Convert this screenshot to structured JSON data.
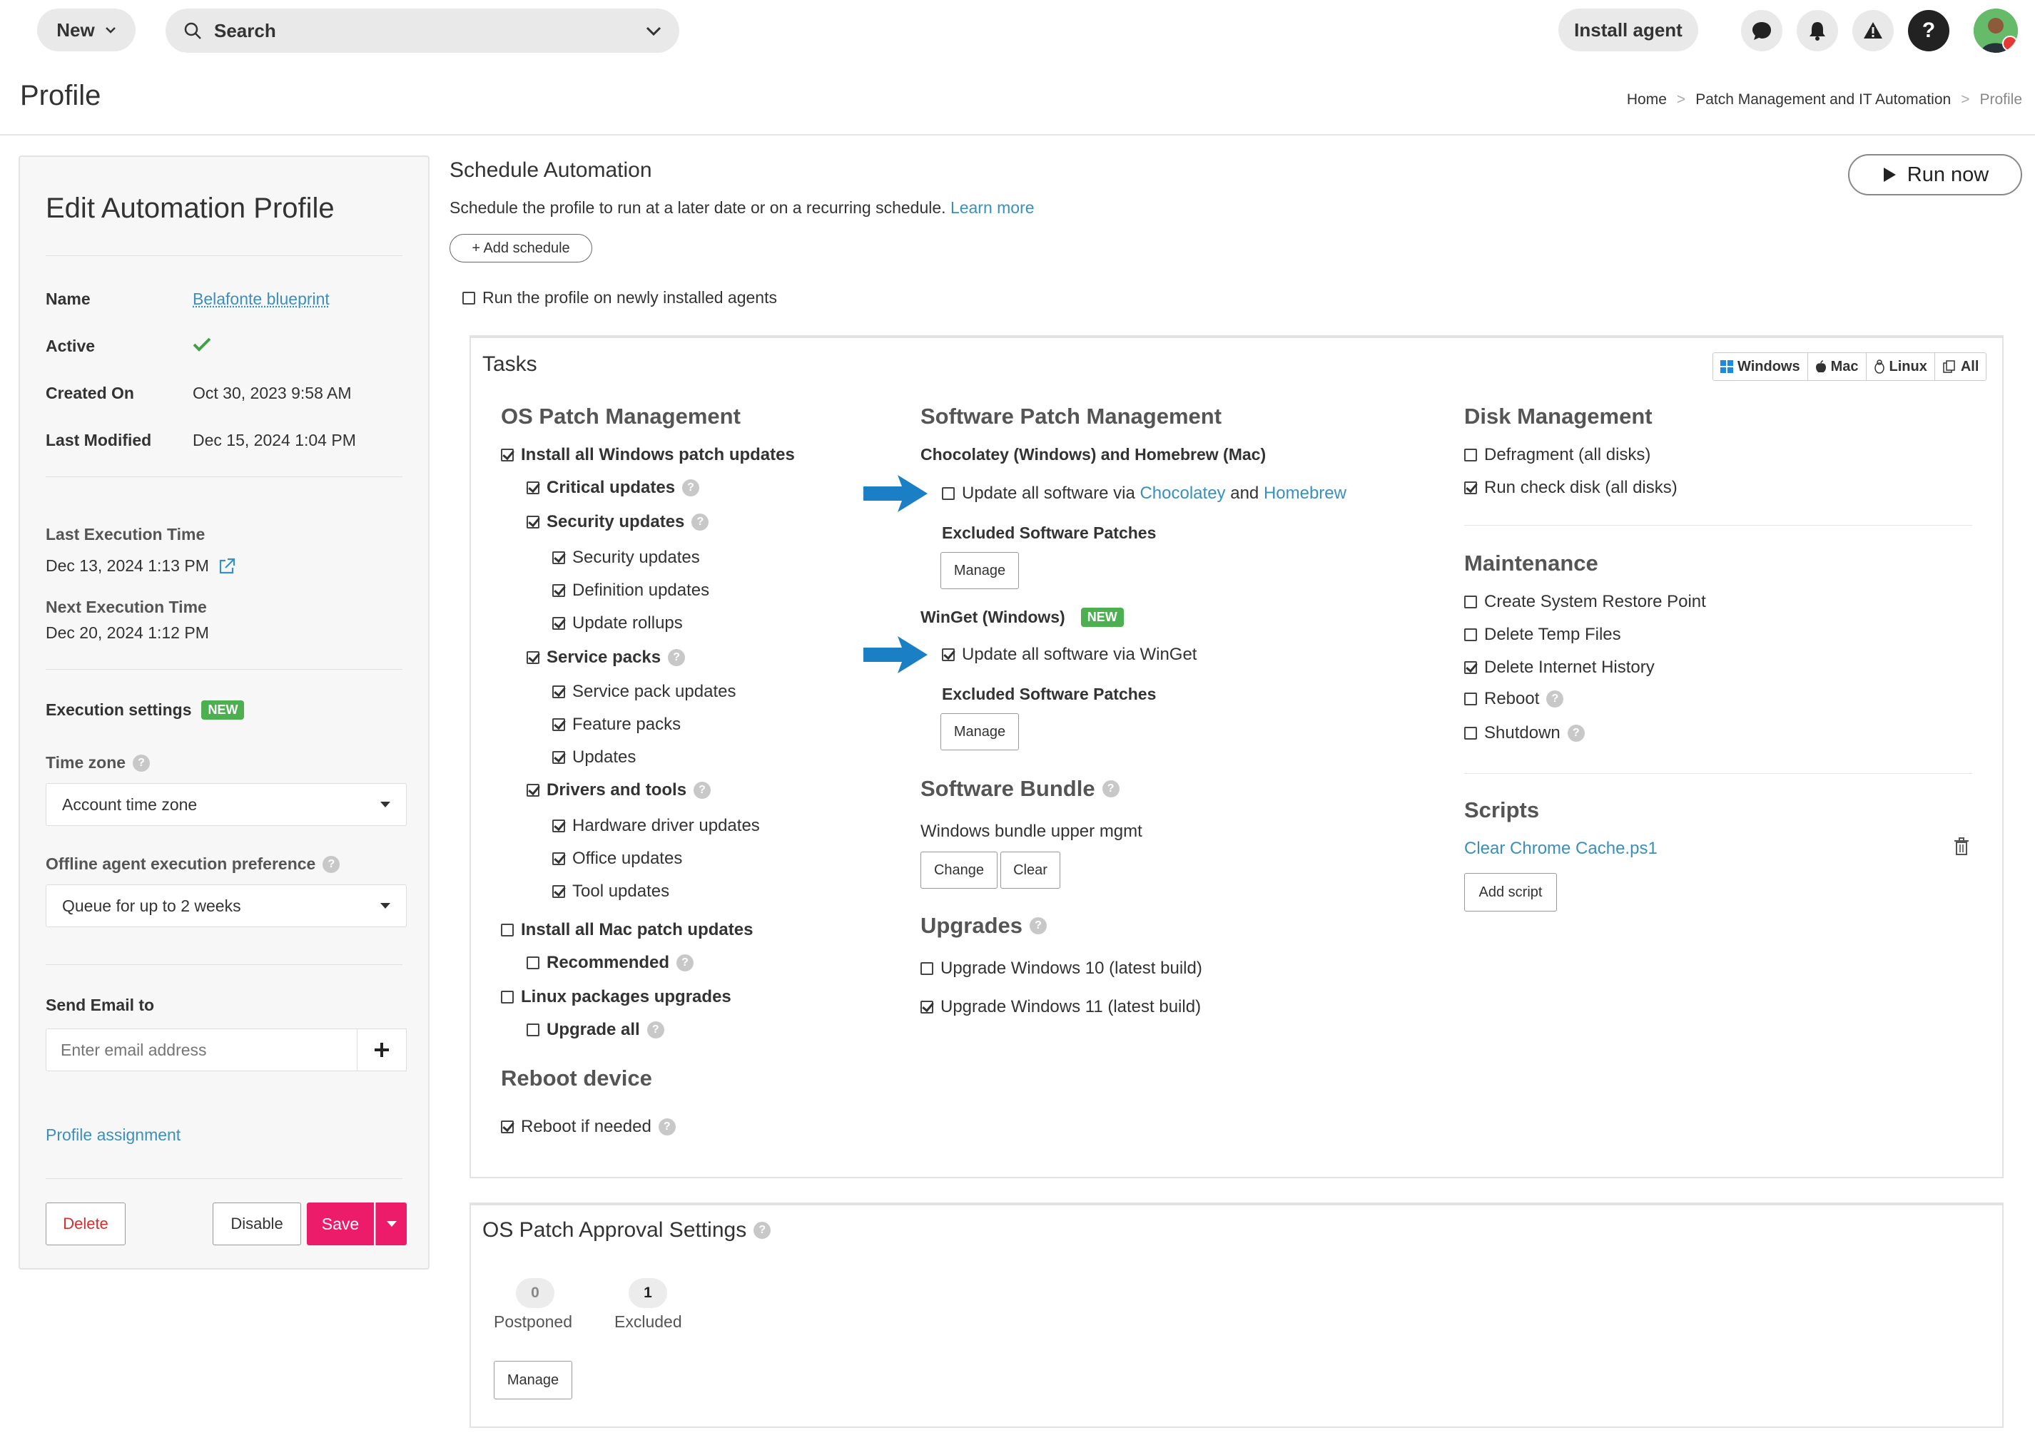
{
  "topbar": {
    "new_label": "New",
    "search_label": "Search",
    "install_label": "Install agent",
    "help_label": "?"
  },
  "page": {
    "title": "Profile",
    "breadcrumb": [
      "Home",
      "Patch Management and IT Automation",
      "Profile"
    ]
  },
  "left": {
    "title": "Edit Automation Profile",
    "fields": [
      {
        "label": "Name",
        "value": "Belafonte blueprint"
      },
      {
        "label": "Active",
        "value": ""
      },
      {
        "label": "Created On",
        "value": "Oct 30, 2023 9:58 AM"
      },
      {
        "label": "Last Modified",
        "value": "Dec 15, 2024 1:04 PM"
      }
    ],
    "last_exec_label": "Last Execution Time",
    "last_exec_value": "Dec 13, 2024 1:13 PM",
    "next_exec_label": "Next Execution Time",
    "next_exec_value": "Dec 20, 2024 1:12 PM",
    "exec_settings_label": "Execution settings",
    "new_badge": "NEW",
    "timezone_label": "Time zone",
    "timezone_value": "Account time zone",
    "offline_label": "Offline agent execution preference",
    "offline_value": "Queue for up to 2 weeks",
    "email_label": "Send Email to",
    "email_placeholder": "Enter email address",
    "assignment_link": "Profile assignment",
    "delete_label": "Delete",
    "disable_label": "Disable",
    "save_label": "Save"
  },
  "schedule": {
    "title": "Schedule Automation",
    "desc": "Schedule the profile to run at a later date or on a recurring schedule.",
    "learn_more": "Learn more",
    "add_schedule": "+ Add schedule",
    "run_new_agents": "Run the profile on newly installed agents",
    "run_now": "Run now"
  },
  "tasks": {
    "title": "Tasks",
    "os_filters": [
      "Windows",
      "Mac",
      "Linux",
      "All"
    ],
    "os_patch": {
      "title": "OS Patch Management",
      "items": [
        {
          "label": "Install all Windows patch updates",
          "checked": true,
          "level": 0,
          "bold": true,
          "help": false
        },
        {
          "label": "Critical updates",
          "checked": true,
          "level": 1,
          "bold": true,
          "help": true
        },
        {
          "label": "Security updates",
          "checked": true,
          "level": 1,
          "bold": true,
          "help": true
        },
        {
          "label": "Security updates",
          "checked": true,
          "level": 2,
          "bold": false,
          "help": false
        },
        {
          "label": "Definition updates",
          "checked": true,
          "level": 2,
          "bold": false,
          "help": false
        },
        {
          "label": "Update rollups",
          "checked": true,
          "level": 2,
          "bold": false,
          "help": false
        },
        {
          "label": "Service packs",
          "checked": true,
          "level": 1,
          "bold": true,
          "help": true
        },
        {
          "label": "Service pack updates",
          "checked": true,
          "level": 2,
          "bold": false,
          "help": false
        },
        {
          "label": "Feature packs",
          "checked": true,
          "level": 2,
          "bold": false,
          "help": false
        },
        {
          "label": "Updates",
          "checked": true,
          "level": 2,
          "bold": false,
          "help": false
        },
        {
          "label": "Drivers and tools",
          "checked": true,
          "level": 1,
          "bold": true,
          "help": true
        },
        {
          "label": "Hardware driver updates",
          "checked": true,
          "level": 2,
          "bold": false,
          "help": false
        },
        {
          "label": "Office updates",
          "checked": true,
          "level": 2,
          "bold": false,
          "help": false
        },
        {
          "label": "Tool updates",
          "checked": true,
          "level": 2,
          "bold": false,
          "help": false
        },
        {
          "label": "Install all Mac patch updates",
          "checked": false,
          "level": 0,
          "bold": true,
          "help": false
        },
        {
          "label": "Recommended",
          "checked": false,
          "level": 1,
          "bold": true,
          "help": true
        },
        {
          "label": "Linux packages upgrades",
          "checked": false,
          "level": 0,
          "bold": true,
          "help": false
        },
        {
          "label": "Upgrade all",
          "checked": false,
          "level": 1,
          "bold": true,
          "help": true
        }
      ]
    },
    "reboot": {
      "title": "Reboot device",
      "label": "Reboot if needed"
    },
    "software": {
      "title": "Software Patch Management",
      "choco_title": "Chocolatey (Windows) and Homebrew (Mac)",
      "choco_prefix": "Update all software via",
      "choco_link1": "Chocolatey",
      "choco_and": "and",
      "choco_link2": "Homebrew",
      "excluded": "Excluded Software Patches",
      "manage": "Manage",
      "winget_title": "WinGet (Windows)",
      "winget_label": "Update all software via WinGet"
    },
    "bundle": {
      "title": "Software Bundle",
      "value": "Windows bundle upper mgmt",
      "change": "Change",
      "clear": "Clear"
    },
    "upgrades": {
      "title": "Upgrades",
      "items": [
        {
          "label": "Upgrade Windows 10 (latest build)",
          "checked": false
        },
        {
          "label": "Upgrade Windows 11 (latest build)",
          "checked": true
        }
      ]
    },
    "disk": {
      "title": "Disk Management",
      "items": [
        {
          "label": "Defragment (all disks)",
          "checked": false
        },
        {
          "label": "Run check disk (all disks)",
          "checked": true
        }
      ]
    },
    "maintenance": {
      "title": "Maintenance",
      "items": [
        {
          "label": "Create System Restore Point",
          "checked": false,
          "help": false
        },
        {
          "label": "Delete Temp Files",
          "checked": false,
          "help": false
        },
        {
          "label": "Delete Internet History",
          "checked": true,
          "help": false
        },
        {
          "label": "Reboot",
          "checked": false,
          "help": true
        },
        {
          "label": "Shutdown",
          "checked": false,
          "help": true
        }
      ]
    },
    "scripts": {
      "title": "Scripts",
      "script": "Clear Chrome Cache.ps1",
      "add": "Add script"
    }
  },
  "approval": {
    "title": "OS Patch Approval Settings",
    "postponed_count": "0",
    "postponed_label": "Postponed",
    "excluded_count": "1",
    "excluded_label": "Excluded",
    "manage": "Manage"
  }
}
